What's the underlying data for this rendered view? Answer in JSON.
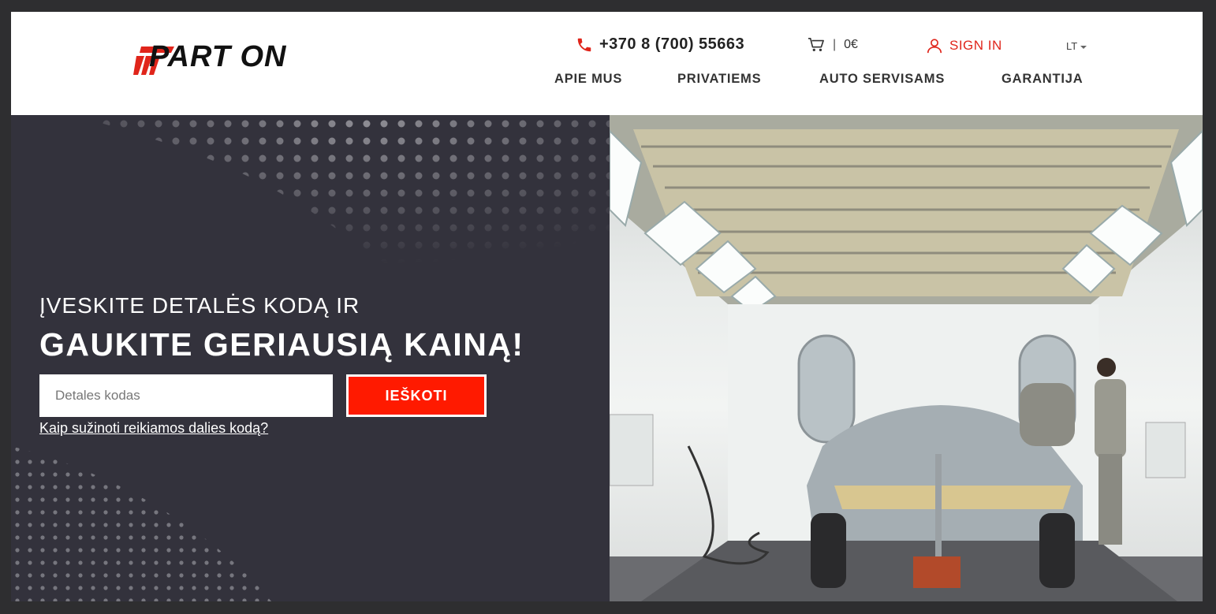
{
  "header": {
    "logo_text": "PART ON",
    "phone": "+370 8 (700) 55663",
    "cart_sep": "|",
    "cart_total": "0€",
    "signin_label": "SIGN IN",
    "lang": "LT"
  },
  "nav": {
    "items": [
      {
        "label": "APIE MUS"
      },
      {
        "label": "PRIVATIEMS"
      },
      {
        "label": "AUTO SERVISAMS"
      },
      {
        "label": "GARANTIJA"
      }
    ]
  },
  "hero": {
    "line1": "ĮVESKITE DETALĖS KODĄ IR",
    "line2": "GAUKITE GERIAUSIĄ KAINĄ!",
    "search_placeholder": "Detales kodas",
    "search_value": "",
    "search_button": "IEŠKOTI",
    "help_link": "Kaip sužinoti reikiamos dalies kodą?"
  },
  "colors": {
    "accent": "#ff1a00",
    "brand_red": "#e0251b",
    "hero_bg": "#33323c",
    "frame_bg": "#2e2e30"
  },
  "icons": [
    "phone-icon",
    "cart-icon",
    "user-icon",
    "caret-down-icon"
  ]
}
